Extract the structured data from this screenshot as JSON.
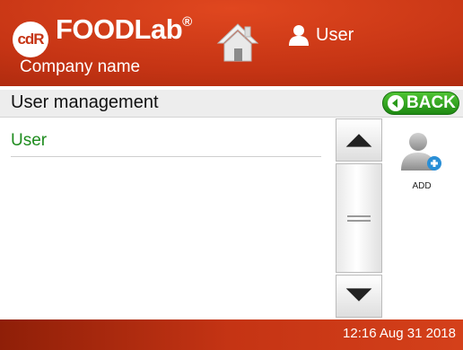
{
  "header": {
    "logo_badge": "cdR",
    "brand": "FOODLab",
    "brand_mark": "®",
    "company": "Company name",
    "user_label": "User"
  },
  "page": {
    "title": "User management",
    "back_label": "BACK"
  },
  "list": {
    "items": [
      {
        "label": "User"
      }
    ]
  },
  "actions": {
    "add_label": "ADD"
  },
  "footer": {
    "datetime": "12:16  Aug 31 2018"
  },
  "colors": {
    "header_red": "#c53414",
    "accent_green": "#1e8c1e",
    "back_green": "#35a821"
  },
  "icons": [
    "home-icon",
    "user-icon",
    "back-arrow-icon",
    "scroll-up-icon",
    "scroll-down-icon",
    "add-user-icon"
  ]
}
